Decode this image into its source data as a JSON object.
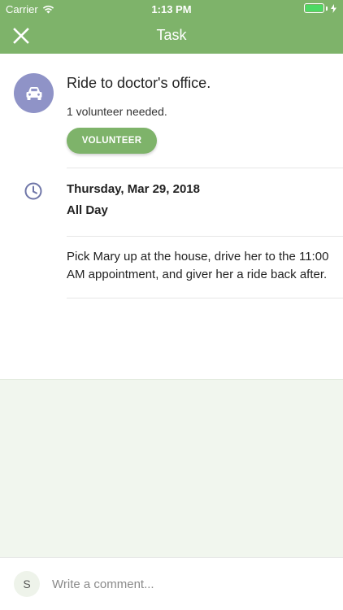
{
  "status_bar": {
    "carrier": "Carrier",
    "time": "1:13 PM",
    "battery_color": "#4cd964"
  },
  "nav": {
    "title": "Task",
    "close_icon": "close-icon",
    "bar_color": "#7eb36a"
  },
  "task": {
    "icon": "car-icon",
    "icon_bg": "#8f93c7",
    "title": "Ride to doctor's office.",
    "volunteers_needed": "1 volunteer needed.",
    "volunteer_button": "VOLUNTEER",
    "date_icon": "clock-icon",
    "date": "Thursday, Mar 29, 2018",
    "time": "All Day",
    "description": "Pick Mary up at the house, drive her to the 11:00 AM appointment, and giver her a ride back after."
  },
  "comment": {
    "avatar_initial": "S",
    "placeholder": "Write a comment..."
  }
}
